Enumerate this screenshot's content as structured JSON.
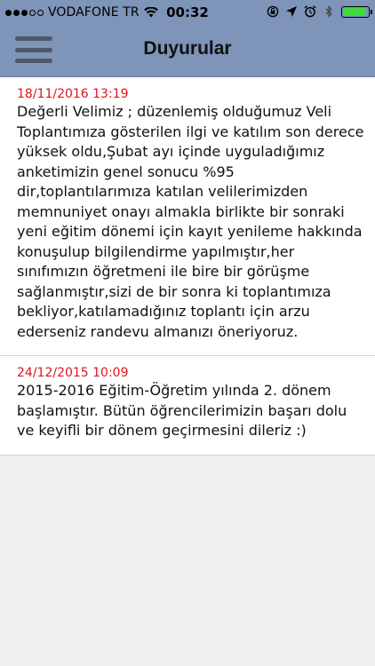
{
  "status_bar": {
    "carrier": "VODAFONE TR",
    "time": "00:32",
    "battery_level": 0.9,
    "battery_color": "#3ddc3a",
    "signal_bars": 3,
    "signal_max": 5
  },
  "nav": {
    "title": "Duyurular",
    "menu_icon": "hamburger-menu-icon",
    "background_color": "#7e94b8"
  },
  "announcements": [
    {
      "date": "18/11/2016 13:19",
      "text": "Değerli Velimiz ; düzenlemiş olduğumuz Veli Toplantımıza gösterilen ilgi ve katılım son derece yüksek oldu,Şubat ayı içinde uyguladığımız anketimizin genel sonucu %95 dir,toplantılarımıza katılan velilerimizden memnuniyet onayı almakla birlikte bir sonraki yeni eğitim dönemi için kayıt yenileme hakkında konuşulup bilgilendirme yapılmıştır,her sınıfımızın öğretmeni ile bire bir görüşme sağlanmıştır,sizi de bir sonra ki toplantımıza bekliyor,katılamadığınız toplantı için arzu ederseniz randevu almanızı öneriyoruz."
    },
    {
      "date": "24/12/2015 10:09",
      "text": "2015-2016 Eğitim-Öğretim yılında 2. dönem başlamıştır. Bütün öğrencilerimizin başarı dolu ve keyifli bir dönem geçirmesini dileriz :)"
    }
  ],
  "colors": {
    "date_color": "#e0141e",
    "text_color": "#111111",
    "page_background": "#efefef"
  }
}
